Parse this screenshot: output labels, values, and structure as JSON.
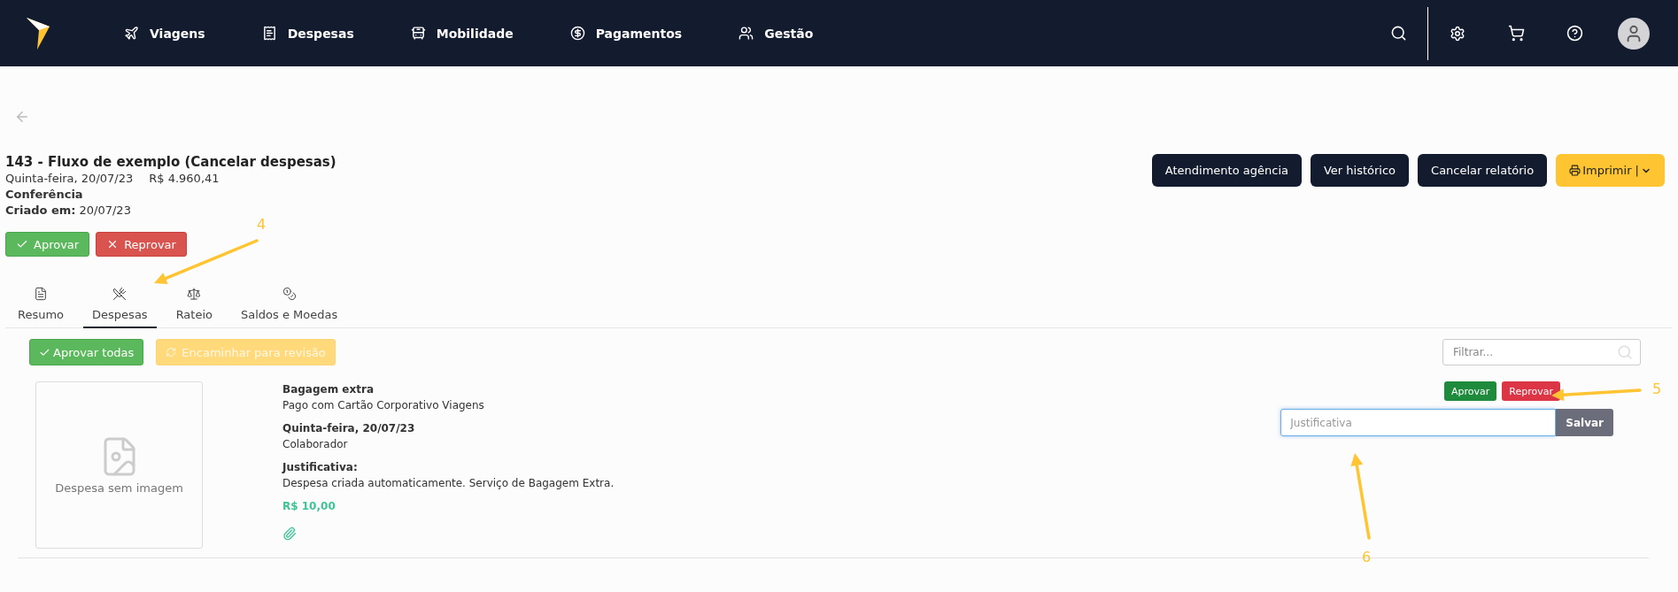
{
  "nav": {
    "items": [
      {
        "kind": "plane",
        "label": "Viagens"
      },
      {
        "kind": "receipt",
        "label": "Despesas"
      },
      {
        "kind": "bus",
        "label": "Mobilidade"
      },
      {
        "kind": "dollar",
        "label": "Pagamentos"
      },
      {
        "kind": "users",
        "label": "Gestão"
      }
    ]
  },
  "report": {
    "title": "143 - Fluxo de exemplo (Cancelar despesas)",
    "date": "Quinta-feira, 20/07/23",
    "total": "R$ 4.960,41",
    "stage": "Conferência",
    "created_label": "Criado em:",
    "created_value": "20/07/23"
  },
  "header_actions": [
    {
      "kind": "dark",
      "label": "Atendimento agência"
    },
    {
      "kind": "dark",
      "label": "Ver histórico"
    },
    {
      "kind": "dark",
      "label": "Cancelar relatório"
    },
    {
      "kind": "print",
      "label": "Imprimir |"
    }
  ],
  "decision_buttons": [
    {
      "kind": "approve",
      "label": "Aprovar"
    },
    {
      "kind": "reject",
      "label": "Reprovar"
    }
  ],
  "tabs": [
    {
      "kind": "summary",
      "label": "Resumo",
      "selected": false
    },
    {
      "kind": "expenses",
      "label": "Despesas",
      "selected": true
    },
    {
      "kind": "split",
      "label": "Rateio",
      "selected": false
    },
    {
      "kind": "coins",
      "label": "Saldos e Moedas",
      "selected": false
    }
  ],
  "toolbar": {
    "approve_all": "Aprovar todas",
    "forward": {
      "label": "Encaminhar para revisão",
      "disabled": true
    },
    "filter_placeholder": "Filtrar..."
  },
  "expense": {
    "image_text": "Despesa sem imagem",
    "name": "Bagagem extra",
    "payment": "Pago com Cartão Corporativo Viagens",
    "date": "Quinta-feira, 20/07/23",
    "role": "Colaborador",
    "justification_label": "Justificativa:",
    "justification": "Despesa criada automaticamente. Serviço de Bagagem Extra.",
    "amount": "R$ 10,00",
    "approve": "Aprovar",
    "reject": "Reprovar",
    "input_placeholder": "Justificativa",
    "input_focused": true,
    "save": "Salvar"
  },
  "annotations": [
    {
      "label": "4"
    },
    {
      "label": "5"
    },
    {
      "label": "6"
    }
  ]
}
